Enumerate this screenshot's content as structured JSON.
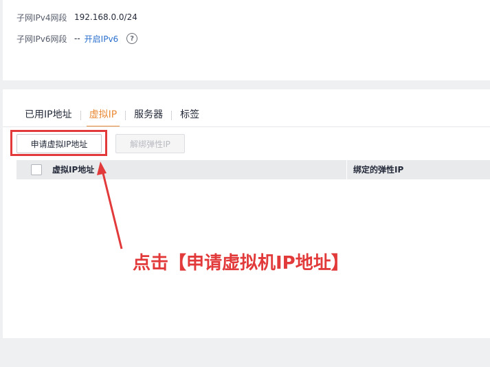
{
  "subnet_info": {
    "ipv4_label": "子网IPv4网段",
    "ipv4_value": "192.168.0.0/24",
    "ipv6_label": "子网IPv6网段",
    "ipv6_dashes": "--",
    "ipv6_link": "开启IPv6",
    "help_glyph": "?"
  },
  "tabs": [
    {
      "label": "已用IP地址"
    },
    {
      "label": "虚拟IP"
    },
    {
      "label": "服务器"
    },
    {
      "label": "标签"
    }
  ],
  "active_tab": "虚拟IP",
  "buttons": {
    "apply_label": "申请虚拟IP地址",
    "unbind_label": "解绑弹性IP"
  },
  "table": {
    "columns": [
      "虚拟IP地址",
      "绑定的弹性IP"
    ]
  },
  "annotation": {
    "text": "点击【申请虚拟机IP地址】",
    "color": "#e23a3a"
  },
  "colors": {
    "accent": "#e98a36",
    "link": "#2a6fce",
    "highlight": "#e23a3a"
  }
}
